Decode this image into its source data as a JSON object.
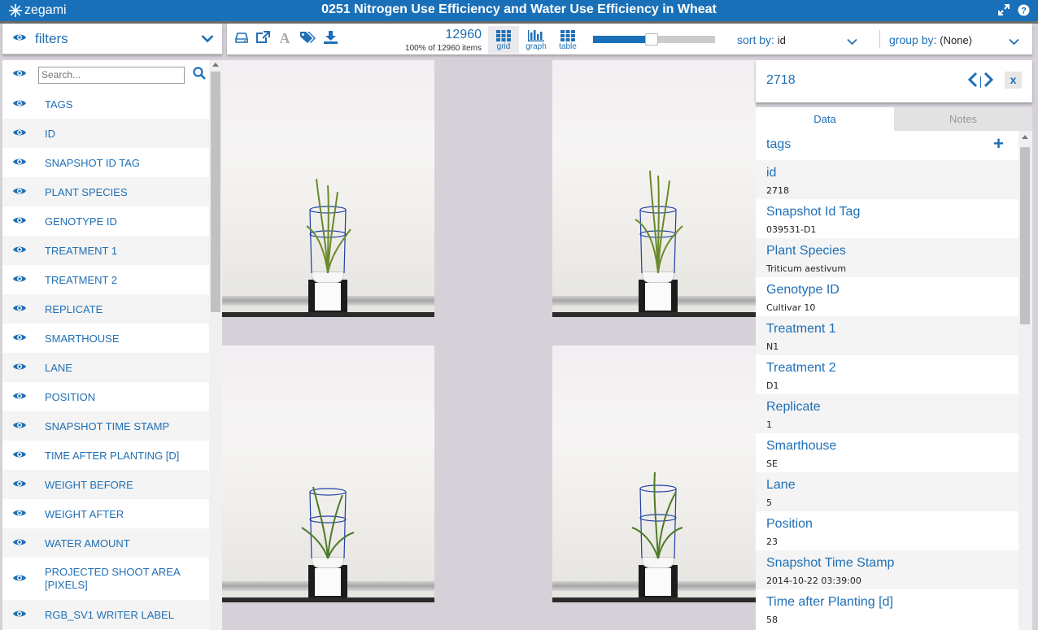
{
  "app": {
    "logo_text": "zegami",
    "title": "0251 Nitrogen Use Efficiency and Water Use Efficiency in Wheat",
    "icons": [
      "expand-icon",
      "help-icon"
    ]
  },
  "colors": {
    "brand": "#1a70b8",
    "link": "#1f6fb5",
    "background": "#d6d1d8"
  },
  "filters": {
    "label": "filters",
    "search_placeholder": "Search...",
    "items": [
      "TAGS",
      "ID",
      "SNAPSHOT ID TAG",
      "PLANT SPECIES",
      "GENOTYPE ID",
      "TREATMENT 1",
      "TREATMENT 2",
      "REPLICATE",
      "SMARTHOUSE",
      "LANE",
      "POSITION",
      "SNAPSHOT TIME STAMP",
      "TIME AFTER PLANTING [D]",
      "WEIGHT BEFORE",
      "WEIGHT AFTER",
      "WATER AMOUNT",
      "PROJECTED SHOOT AREA [PIXELS]",
      "RGB_SV1 WRITER LABEL"
    ]
  },
  "toolbar": {
    "tool_icons": [
      "drive-icon",
      "external-link-icon",
      "font-icon",
      "tags-icon",
      "download-icon"
    ],
    "count": "12960",
    "count_sub": "100% of 12960 items",
    "views": [
      {
        "label": "grid",
        "icon": "grid-icon",
        "active": true
      },
      {
        "label": "graph",
        "icon": "bar-chart-icon",
        "active": false
      },
      {
        "label": "table",
        "icon": "table-icon",
        "active": false
      }
    ],
    "zoom_level": 0.48,
    "sort_label": "sort by:",
    "sort_value": "id",
    "group_label": "group by:",
    "group_value": "(None)"
  },
  "detail": {
    "id": "2718",
    "tab_data": "Data",
    "tab_notes": "Notes",
    "tags_label": "tags",
    "fields": [
      {
        "key": "id",
        "value": "2718"
      },
      {
        "key": "Snapshot Id Tag",
        "value": "039531-D1"
      },
      {
        "key": "Plant Species",
        "value": "Triticum aestivum"
      },
      {
        "key": "Genotype ID",
        "value": "Cultivar 10"
      },
      {
        "key": "Treatment 1",
        "value": "N1"
      },
      {
        "key": "Treatment 2",
        "value": "D1"
      },
      {
        "key": "Replicate",
        "value": "1"
      },
      {
        "key": "Smarthouse",
        "value": "SE"
      },
      {
        "key": "Lane",
        "value": "5"
      },
      {
        "key": "Position",
        "value": "23"
      },
      {
        "key": "Snapshot Time Stamp",
        "value": "2014-10-22 03:39:00"
      },
      {
        "key": "Time after Planting [d]",
        "value": "58"
      }
    ]
  }
}
